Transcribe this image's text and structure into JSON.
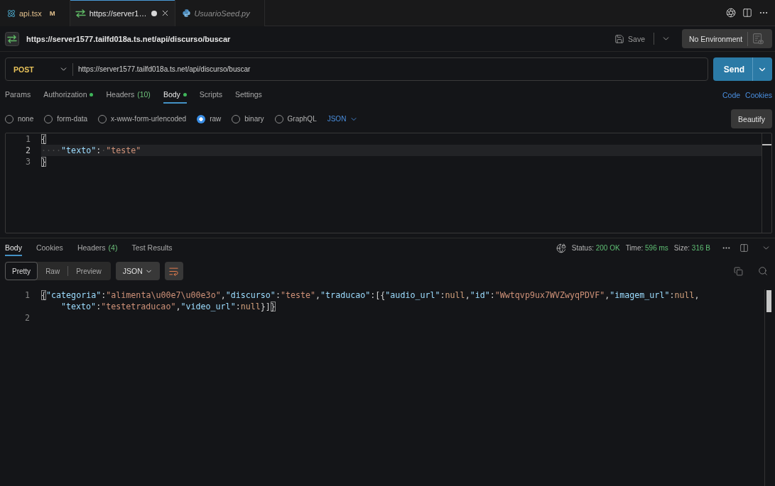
{
  "editor_tabs": [
    {
      "label": "api.tsx",
      "kind": "tsx",
      "badge": "M",
      "modified": true,
      "dirty": false,
      "preview": false,
      "selected": false
    },
    {
      "label": "https://server1…",
      "kind": "http",
      "modified": false,
      "dirty": true,
      "preview": false,
      "selected": true
    },
    {
      "label": "UsuarioSeed.py",
      "kind": "python",
      "modified": false,
      "dirty": false,
      "preview": true,
      "selected": false
    }
  ],
  "request": {
    "title": "https://server1577.tailfd018a.ts.net/api/discurso/buscar",
    "save_label": "Save",
    "environment": "No Environment",
    "method": "POST",
    "url": "https://server1577.tailfd018a.ts.net/api/discurso/buscar",
    "send_label": "Send",
    "tabs": [
      {
        "label": "Params",
        "dot": false,
        "selected": false
      },
      {
        "label": "Authorization",
        "dot": true,
        "selected": false
      },
      {
        "label": "Headers",
        "count": "(10)",
        "dot": false,
        "selected": false
      },
      {
        "label": "Body",
        "dot": true,
        "selected": true
      },
      {
        "label": "Scripts",
        "dot": false,
        "selected": false
      },
      {
        "label": "Settings",
        "dot": false,
        "selected": false
      }
    ],
    "links": [
      "Code",
      "Cookies"
    ],
    "body_types": [
      {
        "label": "none",
        "selected": false
      },
      {
        "label": "form-data",
        "selected": false
      },
      {
        "label": "x-www-form-urlencoded",
        "selected": false
      },
      {
        "label": "raw",
        "selected": true
      },
      {
        "label": "binary",
        "selected": false
      },
      {
        "label": "GraphQL",
        "selected": false
      }
    ],
    "format": "JSON",
    "beautify_label": "Beautify",
    "editor": {
      "lines": [
        {
          "number": "1",
          "current": false,
          "tokens": [
            {
              "text": "{",
              "kind": "bracket"
            }
          ]
        },
        {
          "number": "2",
          "current": true,
          "tokens": [
            {
              "text": "····",
              "kind": "whitespace"
            },
            {
              "text": "\"texto\"",
              "kind": "key"
            },
            {
              "text": ":",
              "kind": "punct"
            },
            {
              "text": "·",
              "kind": "whitespace"
            },
            {
              "text": "\"teste\"",
              "kind": "string"
            }
          ]
        },
        {
          "number": "3",
          "current": false,
          "tokens": [
            {
              "text": "}",
              "kind": "bracket"
            }
          ]
        }
      ]
    }
  },
  "response": {
    "tabs": [
      {
        "label": "Body",
        "selected": true
      },
      {
        "label": "Cookies",
        "selected": false
      },
      {
        "label": "Headers",
        "count": "(4)",
        "selected": false
      },
      {
        "label": "Test Results",
        "selected": false
      }
    ],
    "stats": [
      {
        "label": "Status:",
        "value": "200 OK"
      },
      {
        "label": "Time:",
        "value": "596 ms"
      },
      {
        "label": "Size:",
        "value": "316 B"
      }
    ],
    "views": [
      {
        "label": "Pretty",
        "selected": true
      },
      {
        "label": "Raw",
        "selected": false
      },
      {
        "label": "Preview",
        "selected": false
      }
    ],
    "format": "JSON",
    "wrap": true,
    "lines": [
      {
        "number": "1",
        "rows": [
          {
            "tokens": [
              {
                "text": "{",
                "kind": "bracket"
              },
              {
                "text": "\"categoria\"",
                "kind": "key"
              },
              {
                "text": ":",
                "kind": "punct"
              },
              {
                "text": "\"alimenta\\u00e7\\u00e3o\"",
                "kind": "string"
              },
              {
                "text": ",",
                "kind": "punct"
              },
              {
                "text": "\"discurso\"",
                "kind": "key"
              },
              {
                "text": ":",
                "kind": "punct"
              },
              {
                "text": "\"teste\"",
                "kind": "string"
              },
              {
                "text": ",",
                "kind": "punct"
              },
              {
                "text": "\"traducao\"",
                "kind": "key"
              },
              {
                "text": ":[{",
                "kind": "punct"
              },
              {
                "text": "\"audio_url\"",
                "kind": "key"
              },
              {
                "text": ":",
                "kind": "punct"
              },
              {
                "text": "null",
                "kind": "null"
              },
              {
                "text": ",",
                "kind": "punct"
              },
              {
                "text": "\"id\"",
                "kind": "key"
              },
              {
                "text": ":",
                "kind": "punct"
              },
              {
                "text": "\"Wwtqvp9ux7WVZwyqPDVF\"",
                "kind": "string"
              },
              {
                "text": ",",
                "kind": "punct"
              },
              {
                "text": "\"imagem_url\"",
                "kind": "key"
              },
              {
                "text": ":",
                "kind": "punct"
              },
              {
                "text": "null",
                "kind": "null"
              },
              {
                "text": ",",
                "kind": "punct"
              }
            ]
          },
          {
            "tokens": [
              {
                "text": "\"texto\"",
                "kind": "key"
              },
              {
                "text": ":",
                "kind": "punct"
              },
              {
                "text": "\"testetraducao\"",
                "kind": "string"
              },
              {
                "text": ",",
                "kind": "punct"
              },
              {
                "text": "\"video_url\"",
                "kind": "key"
              },
              {
                "text": ":",
                "kind": "punct"
              },
              {
                "text": "null",
                "kind": "null"
              },
              {
                "text": "}]",
                "kind": "punct"
              },
              {
                "text": "}",
                "kind": "bracket"
              }
            ]
          }
        ]
      },
      {
        "number": "2"
      }
    ]
  }
}
